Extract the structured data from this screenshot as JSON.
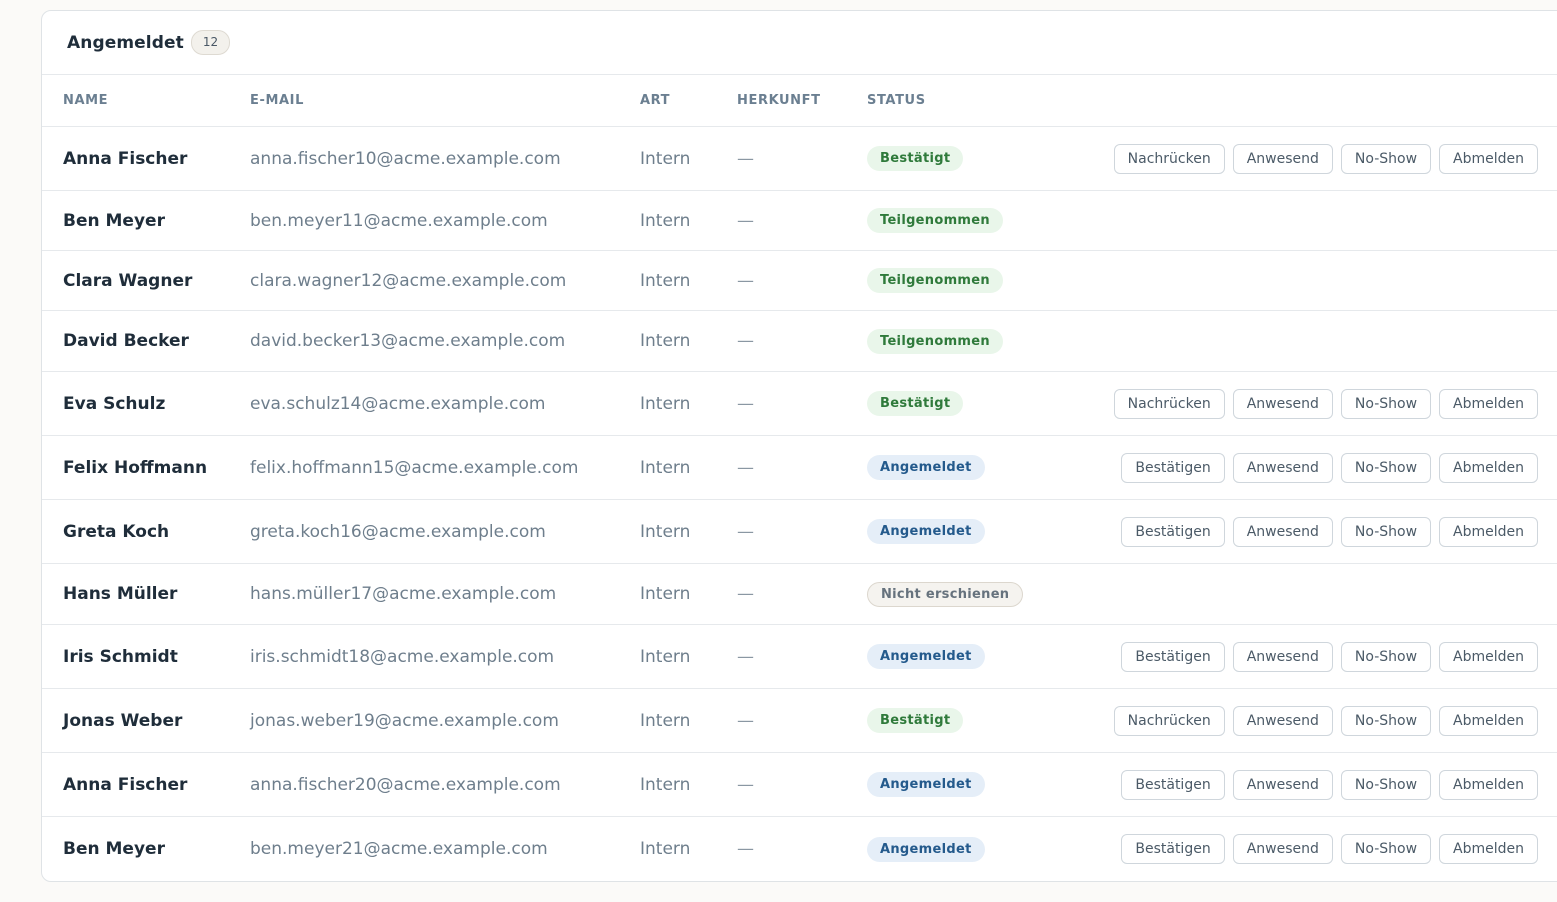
{
  "card": {
    "title": "Angemeldet",
    "count": "12"
  },
  "columns": {
    "name": "NAME",
    "email": "E-MAIL",
    "art": "ART",
    "herkunft": "HERKUNFT",
    "status": "STATUS"
  },
  "rows": [
    {
      "name": "Anna Fischer",
      "email": "anna.fischer10@acme.example.com",
      "art": "Intern",
      "herkunft": "—",
      "status": "Bestätigt",
      "status_color": "#2f7a3b",
      "actions": [
        "Nachrücken",
        "Anwesend",
        "No-Show",
        "Abmelden"
      ]
    },
    {
      "name": "Ben Meyer",
      "email": "ben.meyer11@acme.example.com",
      "art": "Intern",
      "herkunft": "—",
      "status": "Teilgenommen",
      "status_color": "#2f7a3b",
      "actions": []
    },
    {
      "name": "Clara Wagner",
      "email": "clara.wagner12@acme.example.com",
      "art": "Intern",
      "herkunft": "—",
      "status": "Teilgenommen",
      "status_color": "#2f7a3b",
      "actions": []
    },
    {
      "name": "David Becker",
      "email": "david.becker13@acme.example.com",
      "art": "Intern",
      "herkunft": "—",
      "status": "Teilgenommen",
      "status_color": "#2f7a3b",
      "actions": []
    },
    {
      "name": "Eva Schulz",
      "email": "eva.schulz14@acme.example.com",
      "art": "Intern",
      "herkunft": "—",
      "status": "Bestätigt",
      "status_color": "#2f7a3b",
      "actions": [
        "Nachrücken",
        "Anwesend",
        "No-Show",
        "Abmelden"
      ]
    },
    {
      "name": "Felix Hoffmann",
      "email": "felix.hoffmann15@acme.example.com",
      "art": "Intern",
      "herkunft": "—",
      "status": "Angemeldet",
      "status_color": "#245a8c",
      "actions": [
        "Bestätigen",
        "Anwesend",
        "No-Show",
        "Abmelden"
      ]
    },
    {
      "name": "Greta Koch",
      "email": "greta.koch16@acme.example.com",
      "art": "Intern",
      "herkunft": "—",
      "status": "Angemeldet",
      "status_color": "#245a8c",
      "actions": [
        "Bestätigen",
        "Anwesend",
        "No-Show",
        "Abmelden"
      ]
    },
    {
      "name": "Hans Müller",
      "email": "hans.müller17@acme.example.com",
      "art": "Intern",
      "herkunft": "—",
      "status": "Nicht erschienen",
      "status_color": "#66727d",
      "actions": []
    },
    {
      "name": "Iris Schmidt",
      "email": "iris.schmidt18@acme.example.com",
      "art": "Intern",
      "herkunft": "—",
      "status": "Angemeldet",
      "status_color": "#245a8c",
      "actions": [
        "Bestätigen",
        "Anwesend",
        "No-Show",
        "Abmelden"
      ]
    },
    {
      "name": "Jonas Weber",
      "email": "jonas.weber19@acme.example.com",
      "art": "Intern",
      "herkunft": "—",
      "status": "Bestätigt",
      "status_color": "#2f7a3b",
      "actions": [
        "Nachrücken",
        "Anwesend",
        "No-Show",
        "Abmelden"
      ]
    },
    {
      "name": "Anna Fischer",
      "email": "anna.fischer20@acme.example.com",
      "art": "Intern",
      "herkunft": "—",
      "status": "Angemeldet",
      "status_color": "#245a8c",
      "actions": [
        "Bestätigen",
        "Anwesend",
        "No-Show",
        "Abmelden"
      ]
    },
    {
      "name": "Ben Meyer",
      "email": "ben.meyer21@acme.example.com",
      "art": "Intern",
      "herkunft": "—",
      "status": "Angemeldet",
      "status_color": "#245a8c",
      "actions": [
        "Bestätigen",
        "Anwesend",
        "No-Show",
        "Abmelden"
      ]
    }
  ]
}
